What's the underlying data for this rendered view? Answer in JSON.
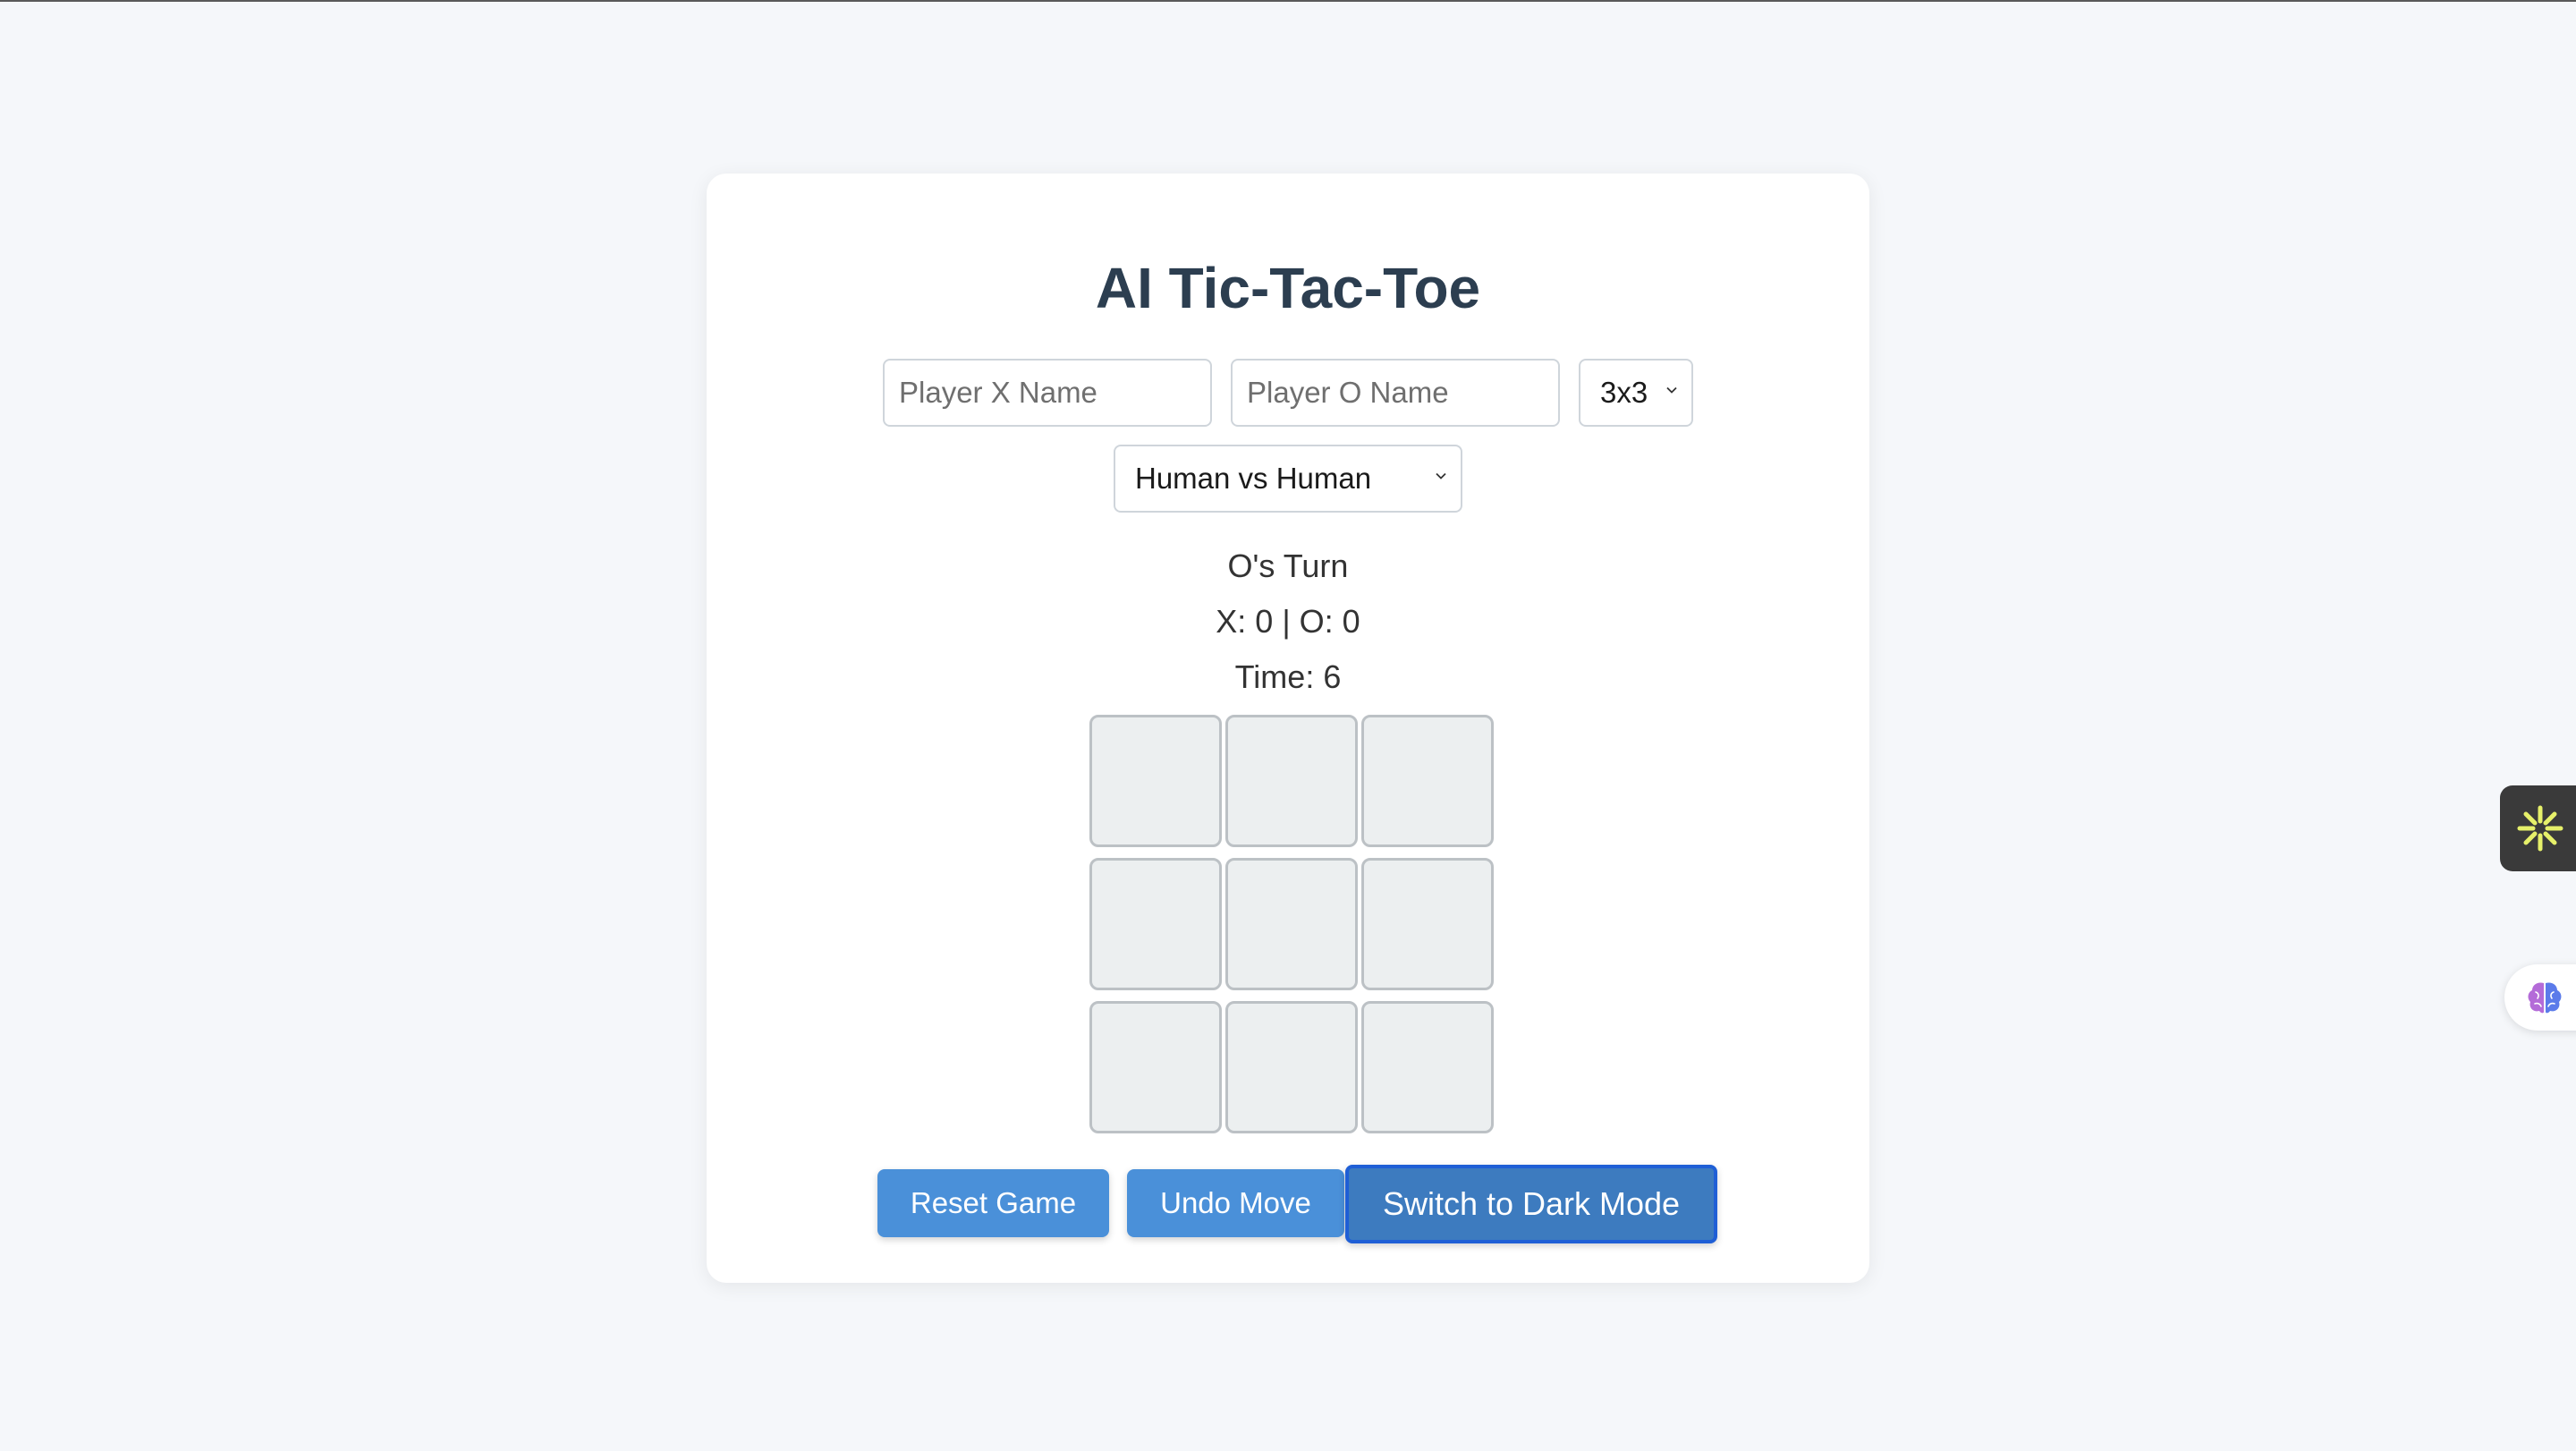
{
  "app": {
    "title": "AI Tic-Tac-Toe"
  },
  "inputs": {
    "player_x": {
      "value": "",
      "placeholder": "Player X Name"
    },
    "player_o": {
      "value": "",
      "placeholder": "Player O Name"
    }
  },
  "selects": {
    "board_size": {
      "selected": "3x3"
    },
    "game_mode": {
      "selected": "Human vs Human"
    }
  },
  "status": {
    "turn": "O's Turn",
    "score": "X: 0 | O: 0",
    "timer": "Time: 6"
  },
  "board": {
    "cells": [
      "",
      "",
      "",
      "",
      "",
      "",
      "",
      "",
      ""
    ]
  },
  "buttons": {
    "reset": "Reset Game",
    "undo": "Undo Move",
    "dark_mode": "Switch to Dark Mode"
  },
  "colors": {
    "button_primary": "#4a90d9",
    "button_focused": "#3d7bbf",
    "cell_bg": "#eceff0",
    "page_bg": "#f5f7fa"
  },
  "icons": {
    "side_widget": "sparkle-icon",
    "side_brain": "brain-icon"
  }
}
